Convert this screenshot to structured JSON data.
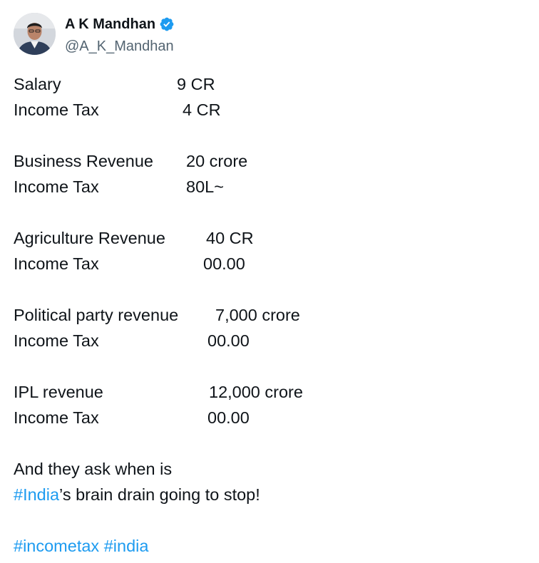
{
  "author": {
    "display_name": "A K Mandhan",
    "handle": "@A_K_Mandhan",
    "verified_icon": "verified-badge-icon",
    "verified_color": "#1d9bf0"
  },
  "tweet": {
    "rows": [
      {
        "label": "Salary",
        "value": "9 CR"
      },
      {
        "label": "Income Tax",
        "value": "4 CR"
      },
      {
        "label": "Business Revenue",
        "value": "20 crore"
      },
      {
        "label": "Income Tax",
        "value": "80L~"
      },
      {
        "label": "Agriculture Revenue",
        "value": "40 CR"
      },
      {
        "label": "Income Tax",
        "value": "00.00"
      },
      {
        "label": "Political party revenue",
        "value": "7,000 crore"
      },
      {
        "label": "Income Tax",
        "value": "00.00"
      },
      {
        "label": "IPL revenue",
        "value": "12,000 crore"
      },
      {
        "label": "Income Tax",
        "value": "00.00"
      }
    ],
    "closing_line_1": "And they ask when is",
    "hashtag_india": "#India",
    "closing_line_2_rest": "’s brain drain going to stop!",
    "hashtag_incometax": "#incometax",
    "hashtag_india_lower": "#india"
  },
  "colors": {
    "text": "#0f1419",
    "secondary_text": "#536471",
    "link": "#1d9bf0"
  }
}
